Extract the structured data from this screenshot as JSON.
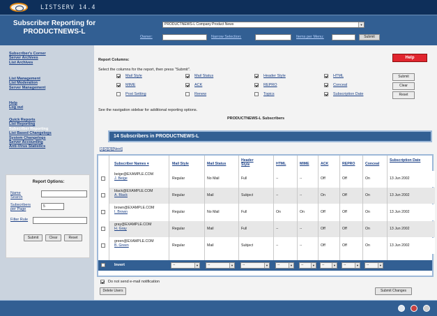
{
  "app": {
    "title": "LISTSERV 14.4"
  },
  "header": {
    "title": "Subscriber Reporting for PRODUCTNEWS-L",
    "list_select_value": "PRODUCTNEWS-L Company Product News",
    "owner_label": "Owner:",
    "owner_value": "",
    "narrow_label": "Narrow Selection:",
    "narrow_value": "",
    "items_label": "Items per Menu:",
    "items_value": "",
    "submit_label": "Submit"
  },
  "sidebar": {
    "groups": [
      [
        "Subscriber's Corner",
        "Server Archives",
        "List Archives"
      ],
      [
        "List Management",
        "List Moderation",
        "Server Management"
      ],
      [
        "Help",
        "Log out"
      ],
      [
        "Quick Reports",
        "List Reporting",
        "Subscriber Reporting",
        "List Based Changelogs",
        "System Changelogs",
        "Server Accounting",
        "Anti-Virus Statistics"
      ]
    ],
    "current": "Subscriber Reporting",
    "options": {
      "title": "Report Options:",
      "name_search_label": "Name Search",
      "name_search_value": "",
      "subs_per_page_label": "Subscribers per Page",
      "subs_per_page_value": "5",
      "filter_rule_label": "Filter Rule",
      "filter_rule_value": "",
      "submit_label": "Submit",
      "clear_label": "Clear",
      "reset_label": "Reset"
    }
  },
  "main": {
    "report_columns_title": "Report Columns:",
    "help_label": "Help",
    "instructions": "Select the columns for the report, then press \"Submit\".",
    "columns": [
      {
        "label": "Mail Style",
        "checked": true
      },
      {
        "label": "Mail Status",
        "checked": true
      },
      {
        "label": "Header Style",
        "checked": true
      },
      {
        "label": "HTML",
        "checked": true
      },
      {
        "label": "MIME",
        "checked": true
      },
      {
        "label": "ACK",
        "checked": true
      },
      {
        "label": "REPRO",
        "checked": true
      },
      {
        "label": "Conceal",
        "checked": true
      },
      {
        "label": "Post Setting",
        "checked": false
      },
      {
        "label": "Renew",
        "checked": false
      },
      {
        "label": "Topics",
        "checked": false
      },
      {
        "label": "Subscription Date",
        "checked": true
      }
    ],
    "submit_label": "Submit",
    "clear_label": "Clear",
    "reset_label": "Reset",
    "see_nav_text": "See the navigation sidebar for additional reporting options.",
    "report_title": "PRODUCTNEWS-L Subscribers",
    "subscribers_header": "14 Subscribers in PRODUCTNEWS-L",
    "pager": [
      "[1]",
      "[2]",
      "[3]",
      "[Next]"
    ],
    "table": {
      "headers": [
        "Subscriber Names",
        "Mail Style",
        "Mail Status",
        "Header Style",
        "HTML",
        "MIME",
        "ACK",
        "REPRO",
        "Conceal",
        "Subscription Date"
      ],
      "rows": [
        {
          "email": "beige@EXAMPLE.COM",
          "name": "J. Beige",
          "mail_style": "Regular",
          "mail_status": "No Mail",
          "header_style": "Full",
          "html": "--",
          "mime": "--",
          "ack": "Off",
          "repro": "Off",
          "conceal": "On",
          "date": "13 Jun 2002"
        },
        {
          "email": "black@EXAMPLE.COM",
          "name": "A. Black",
          "mail_style": "Regular",
          "mail_status": "Mail",
          "header_style": "Subject",
          "html": "--",
          "mime": "--",
          "ack": "On",
          "repro": "Off",
          "conceal": "On",
          "date": "13 Jun 2002"
        },
        {
          "email": "brown@EXAMPLE.COM",
          "name": "I. Brown",
          "mail_style": "Regular",
          "mail_status": "No Mail",
          "header_style": "Full",
          "html": "On",
          "mime": "On",
          "ack": "Off",
          "repro": "Off",
          "conceal": "On",
          "date": "13 Jun 2002"
        },
        {
          "email": "gray@EXAMPLE.COM",
          "name": "H. Gray",
          "mail_style": "Regular",
          "mail_status": "Mail",
          "header_style": "Full",
          "html": "--",
          "mime": "--",
          "ack": "Off",
          "repro": "Off",
          "conceal": "On",
          "date": "13 Jun 2002"
        },
        {
          "email": "green@EXAMPLE.COM",
          "name": "B. Green",
          "mail_style": "Regular",
          "mail_status": "Mail",
          "header_style": "Subject",
          "html": "--",
          "mime": "--",
          "ack": "Off",
          "repro": "Off",
          "conceal": "On",
          "date": "13 Jun 2002"
        }
      ],
      "invert_label": "Invert",
      "invert_selects": [
        "--",
        "--",
        "--",
        "--",
        "--",
        "--",
        "--",
        "--",
        "--"
      ]
    },
    "no_email_label": "Do not send e-mail notification",
    "no_email_checked": true,
    "delete_label": "Delete Users",
    "submit_changes_label": "Submit Changes"
  },
  "colors": {
    "navy": "#0e2f5a",
    "blue": "#325f93",
    "sidebar": "#cad3de",
    "help": "#e1252e"
  }
}
